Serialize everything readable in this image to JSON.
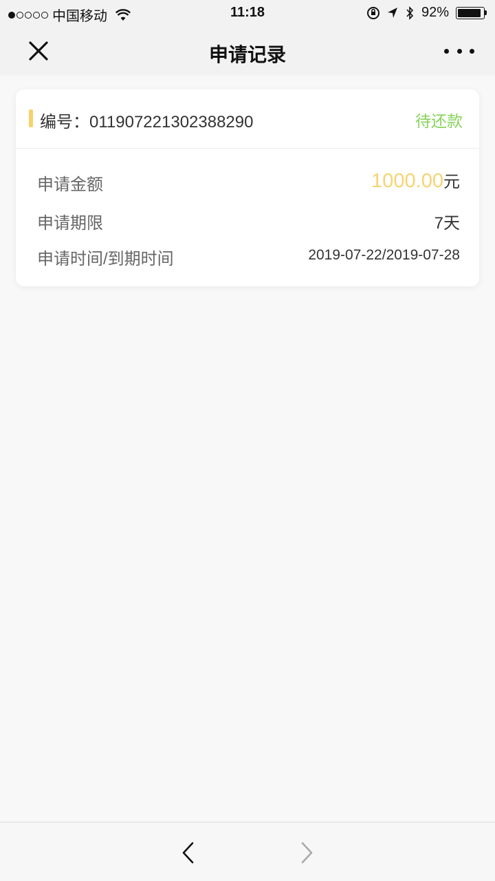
{
  "status_bar": {
    "carrier": "中国移动",
    "time": "11:18",
    "battery": "92%",
    "battery_level": 0.92
  },
  "nav": {
    "title": "申请记录",
    "close_icon": "close-icon",
    "more_icon": "more-dots-icon"
  },
  "record": {
    "number_label": "编号：",
    "number": "011907221302388290",
    "status": "待还款",
    "amount_label": "申请金额",
    "amount_value": "1000.00",
    "amount_unit": "元",
    "term_label": "申请期限",
    "term_value": "7天",
    "date_label": "申请时间/到期时间",
    "date_value": "2019-07-22/2019-07-28"
  },
  "colors": {
    "accent": "#f6d36a",
    "status_green": "#87d35c",
    "amount": "#f7d372"
  },
  "toolbar": {
    "back_icon": "chevron-left-icon",
    "forward_icon": "chevron-right-icon"
  }
}
